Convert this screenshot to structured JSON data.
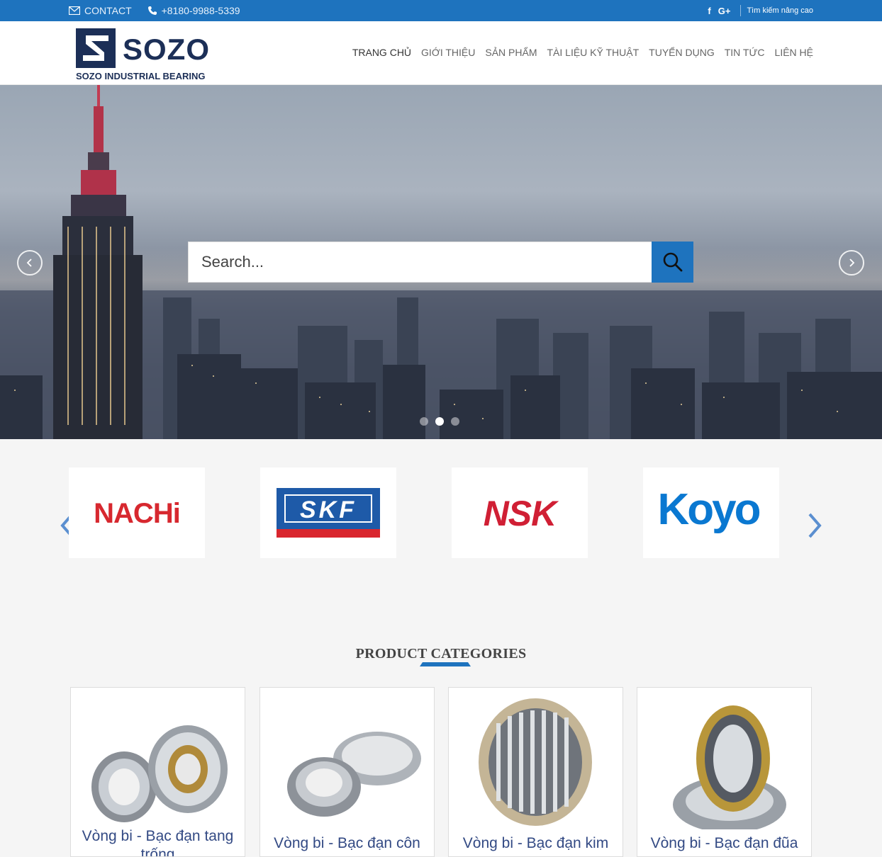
{
  "topbar": {
    "contact_label": "CONTACT",
    "phone": "+8180-9988-5339",
    "social_facebook": "f",
    "social_google": "G+",
    "advanced_search": "Tìm kiếm nâng cao"
  },
  "header": {
    "logo_text": "SOZO",
    "logo_tagline": "SOZO INDUSTRIAL BEARING",
    "nav": [
      {
        "label": "TRANG CHỦ"
      },
      {
        "label": "GIỚI THIỆU"
      },
      {
        "label": "SẢN PHẨM"
      },
      {
        "label": "TÀI LIỆU KỸ THUẬT"
      },
      {
        "label": "TUYỂN DỤNG"
      },
      {
        "label": "TIN TỨC"
      },
      {
        "label": "LIÊN HỆ"
      }
    ]
  },
  "hero": {
    "search_placeholder": "Search...",
    "slide_count": 3,
    "active_slide": 2
  },
  "brands": [
    {
      "name": "NACHi",
      "color": "#d7282f"
    },
    {
      "name": "SKF",
      "color": "#1e5aa8"
    },
    {
      "name": "NSK",
      "color": "#d01f34"
    },
    {
      "name": "Koyo",
      "color": "#0a78d1"
    }
  ],
  "categories_section": {
    "title": "PRODUCT CATEGORIES",
    "items": [
      {
        "label": "Vòng bi - Bạc đạn tang trống"
      },
      {
        "label": "Vòng bi - Bạc đạn côn"
      },
      {
        "label": "Vòng bi - Bạc đạn kim"
      },
      {
        "label": "Vòng bi - Bạc đạn đũa"
      }
    ]
  },
  "colors": {
    "brand_blue": "#1e73be",
    "logo_navy": "#1c2f57",
    "category_text": "#334a84"
  }
}
